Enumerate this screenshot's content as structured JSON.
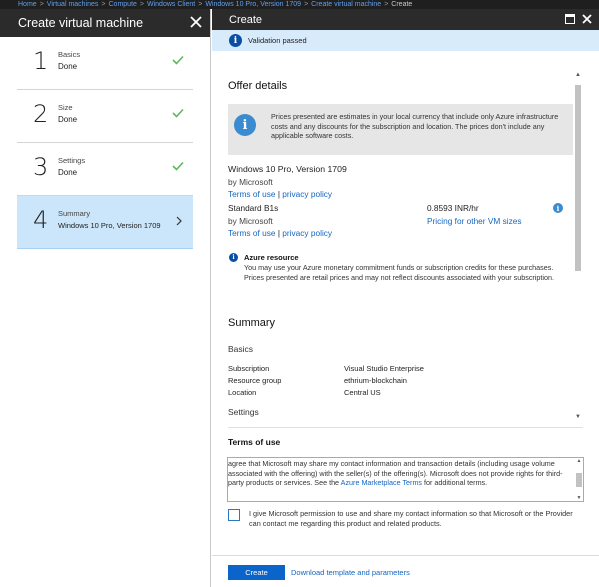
{
  "breadcrumb": {
    "items": [
      "Home",
      "Virtual machines",
      "Compute",
      "Windows Client",
      "Windows 10 Pro, Version 1709",
      "Create virtual machine"
    ],
    "current": "Create",
    "separator": ">"
  },
  "left_blade": {
    "title": "Create virtual machine",
    "steps": [
      {
        "number": "1",
        "title": "Basics",
        "subtitle": "Done",
        "status": "done"
      },
      {
        "number": "2",
        "title": "Size",
        "subtitle": "Done",
        "status": "done"
      },
      {
        "number": "3",
        "title": "Settings",
        "subtitle": "Done",
        "status": "done"
      },
      {
        "number": "4",
        "title": "Summary",
        "subtitle": "Windows 10 Pro, Version 1709",
        "status": "active"
      }
    ]
  },
  "right_blade": {
    "title": "Create",
    "validation": "Validation passed",
    "offer": {
      "title": "Offer details",
      "info": "Prices presented are estimates in your local currency that include only Azure infrastructure costs and any discounts for the subscription and location. The prices don't include any applicable software costs.",
      "product_name": "Windows 10 Pro, Version 1709",
      "product_publisher": "by Microsoft",
      "terms_link": "Terms of use",
      "divider": "|",
      "privacy_link": "privacy policy",
      "size_name": "Standard B1s",
      "size_publisher": "by Microsoft",
      "price": "0.8593 INR/hr",
      "pricing_link": "Pricing for other VM sizes"
    },
    "azure_resource": {
      "title": "Azure resource",
      "text": "You may use your Azure monetary commitment funds or subscription credits for these purchases. Prices presented are retail prices and may not reflect discounts associated with your subscription."
    },
    "summary": {
      "title": "Summary",
      "basics_heading": "Basics",
      "rows": [
        {
          "label": "Subscription",
          "value": "Visual Studio Enterprise"
        },
        {
          "label": "Resource group",
          "value": "ethrium-blockchain"
        },
        {
          "label": "Location",
          "value": "Central US"
        }
      ],
      "settings_heading": "Settings"
    },
    "terms": {
      "title": "Terms of use",
      "text_before": "agree that Microsoft may share my contact information and transaction details (including usage volume associated with the offering) with the seller(s) of the offering(s). Microsoft does not provide rights for third-party products or services. See the ",
      "link": "Azure Marketplace Terms",
      "text_after": " for additional terms."
    },
    "consent": {
      "checked": false,
      "text": "I give Microsoft permission to use and share my contact information so that Microsoft or the Provider can contact me regarding this product and related products."
    },
    "footer": {
      "create_label": "Create",
      "download_label": "Download template and parameters"
    }
  },
  "colors": {
    "header_bg": "#2b2b2b",
    "accent": "#0a64c9",
    "active_step_bg": "#cbe6fa",
    "validation_bg": "#d8ebfa",
    "check_green": "#5cb85c",
    "link": "#1566c0"
  },
  "icons": {
    "close": "close-icon",
    "check": "checkmark-icon",
    "chevron": "chevron-right-icon",
    "info": "info-icon",
    "maximize": "maximize-icon"
  }
}
